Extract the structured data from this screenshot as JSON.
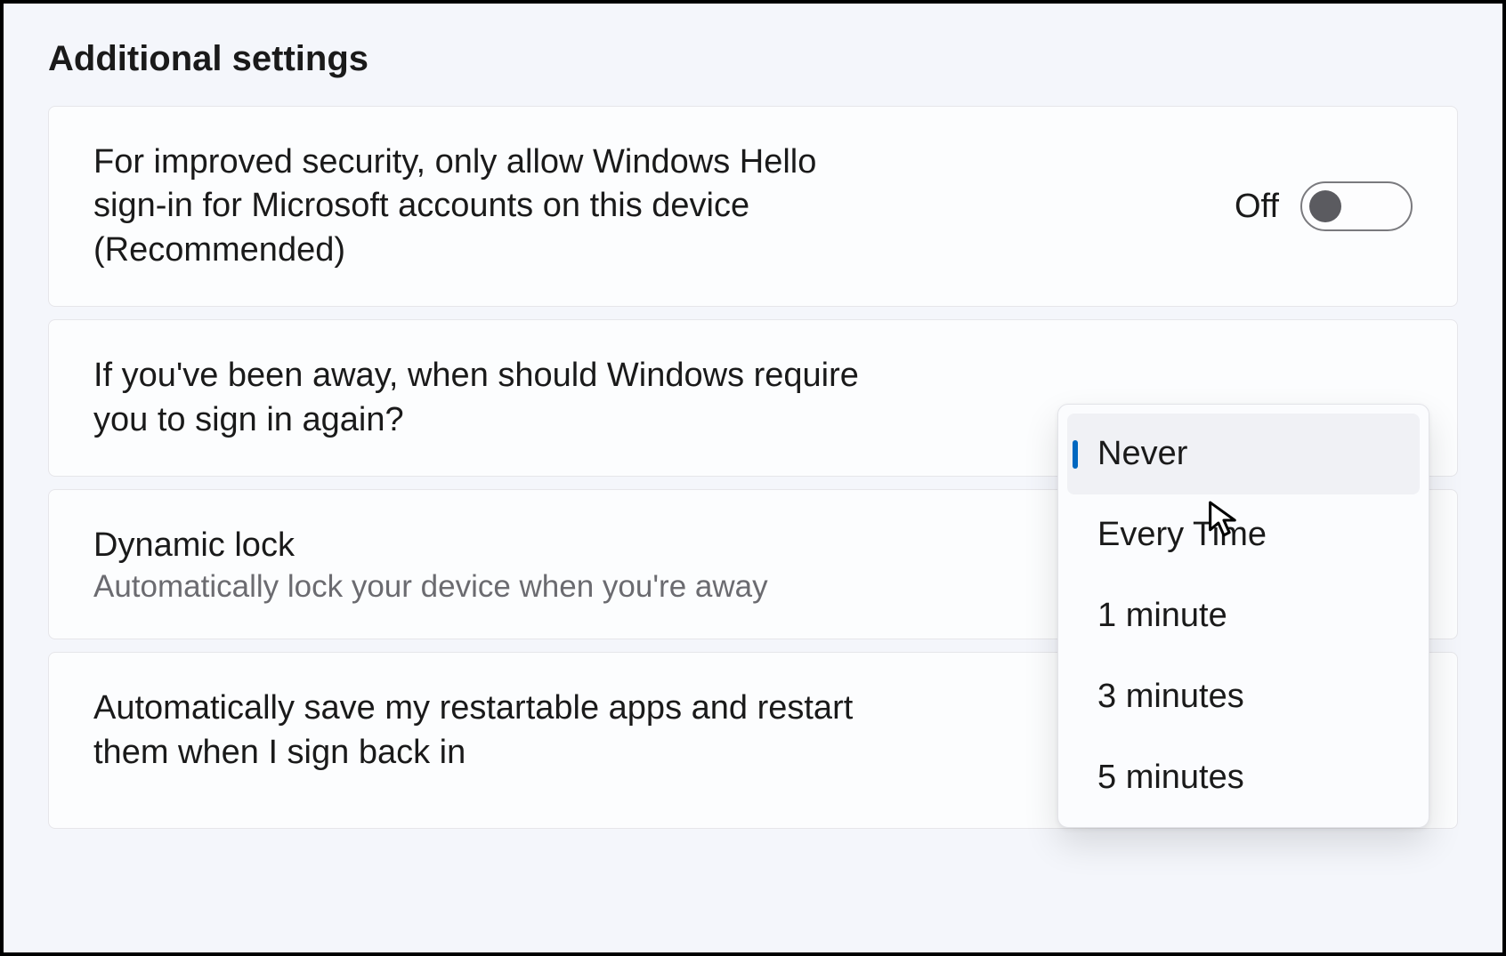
{
  "section_title": "Additional settings",
  "hello_signin": {
    "label": "For improved security, only allow Windows Hello sign-in for Microsoft accounts on this device (Recommended)",
    "state": "Off"
  },
  "require_signin": {
    "label": "If you've been away, when should Windows require you to sign in again?",
    "options": [
      "Never",
      "Every Time",
      "1 minute",
      "3 minutes",
      "5 minutes"
    ],
    "selected": "Never"
  },
  "dynamic_lock": {
    "title": "Dynamic lock",
    "subtitle": "Automatically lock your device when you're away"
  },
  "restart_apps": {
    "label": "Automatically save my restartable apps and restart them when I sign back in"
  }
}
